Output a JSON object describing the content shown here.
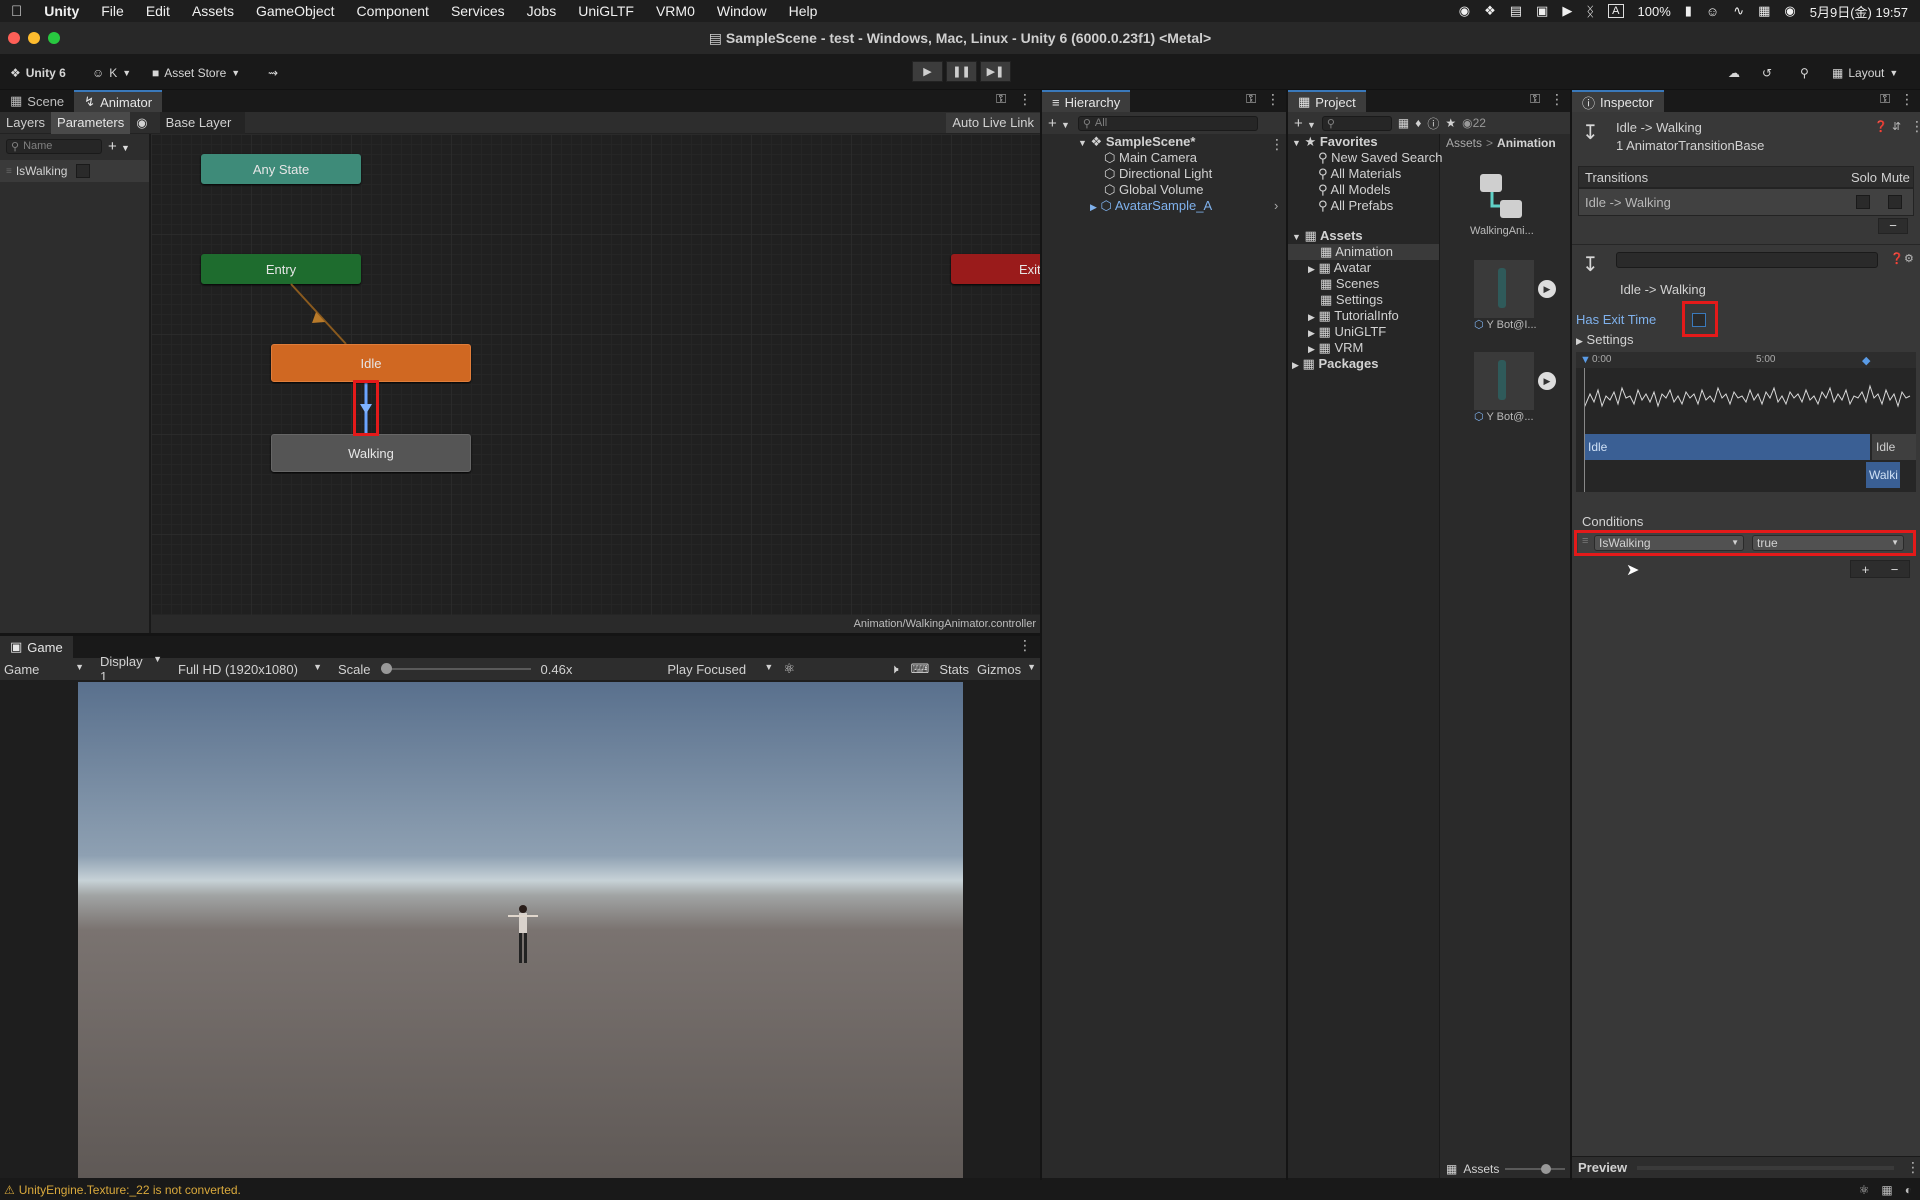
{
  "menubar": {
    "apple": "",
    "items": [
      "Unity",
      "File",
      "Edit",
      "Assets",
      "GameObject",
      "Component",
      "Services",
      "Jobs",
      "UniGLTF",
      "VRM0",
      "Window",
      "Help"
    ],
    "battery": "100%",
    "clock": "5月9日(金) 19:57"
  },
  "window": {
    "title": "SampleScene - test - Windows, Mac, Linux - Unity 6 (6000.0.23f1) <Metal>"
  },
  "toolbar": {
    "unity_label": "Unity 6",
    "account_label": "K",
    "asset_store_label": "Asset Store",
    "layout_label": "Layout"
  },
  "tabs": {
    "scene": "Scene",
    "animator": "Animator",
    "game": "Game",
    "hierarchy": "Hierarchy",
    "project": "Project",
    "inspector": "Inspector"
  },
  "animator": {
    "layers_tab": "Layers",
    "parameters_tab": "Parameters",
    "breadcrumb": "Base Layer",
    "auto_live_link": "Auto Live Link",
    "search_placeholder": "Name",
    "parameter_name": "IsWalking",
    "nodes": {
      "any_state": "Any State",
      "entry": "Entry",
      "exit": "Exit",
      "idle": "Idle",
      "walking": "Walking"
    },
    "controller_path": "Animation/WalkingAnimator.controller"
  },
  "game": {
    "view_dropdown": "Game",
    "display": "Display 1",
    "resolution": "Full HD (1920x1080)",
    "scale_label": "Scale",
    "scale_value": "0.46x",
    "scale_fraction": 0.46,
    "play_focused": "Play Focused",
    "stats": "Stats",
    "gizmos": "Gizmos"
  },
  "hierarchy": {
    "search_placeholder": "All",
    "scene": "SampleScene*",
    "items": [
      "Main Camera",
      "Directional Light",
      "Global Volume",
      "AvatarSample_A"
    ]
  },
  "project": {
    "count": "22",
    "favorites_label": "Favorites",
    "favorites": [
      "New Saved Search",
      "All Materials",
      "All Models",
      "All Prefabs"
    ],
    "assets_label": "Assets",
    "folders": [
      "Animation",
      "Avatar",
      "Scenes",
      "Settings",
      "TutorialInfo",
      "UniGLTF",
      "VRM"
    ],
    "packages_label": "Packages",
    "breadcrumb_root": "Assets",
    "breadcrumb_leaf": "Animation",
    "grid_items": [
      "WalkingAni...",
      "Y Bot@I...",
      "Y Bot@..."
    ],
    "footer": "Assets"
  },
  "inspector": {
    "title": "Idle -> Walking",
    "subtitle": "1 AnimatorTransitionBase",
    "transitions_header": "Transitions",
    "solo": "Solo",
    "mute": "Mute",
    "transition_row": "Idle -> Walking",
    "transition_name": "Idle -> Walking",
    "has_exit_time": "Has Exit Time",
    "settings": "Settings",
    "timeline_ticks": [
      "0:00",
      "5:00"
    ],
    "timeline_idle": "Idle",
    "timeline_idle2": "Idle",
    "timeline_walking": "Walki",
    "conditions": "Conditions",
    "condition_param": "IsWalking",
    "condition_value": "true",
    "preview": "Preview"
  },
  "status": {
    "message": "UnityEngine.Texture:_22 is not converted."
  }
}
